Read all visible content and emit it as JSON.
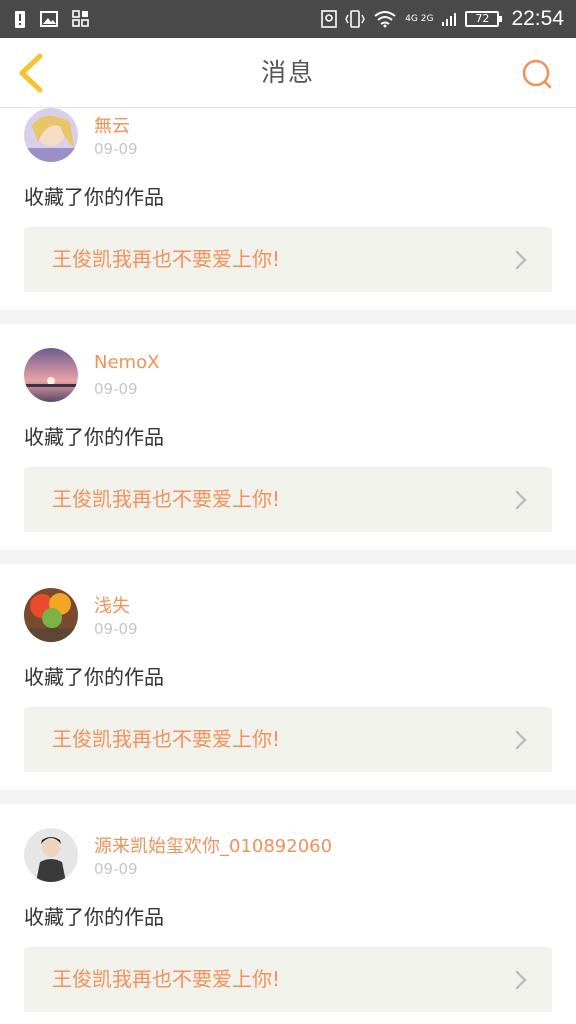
{
  "status_bar": {
    "time": "22:54",
    "battery": "72",
    "network": "4G 2G"
  },
  "header": {
    "title": "消息"
  },
  "notifications": [
    {
      "username": "無云",
      "date": "09-09",
      "action": "收藏了你的作品",
      "work_title": "王俊凯我再也不要爱上你!"
    },
    {
      "username": "NemoX",
      "date": "09-09",
      "action": "收藏了你的作品",
      "work_title": "王俊凯我再也不要爱上你!"
    },
    {
      "username": "浅失",
      "date": "09-09",
      "action": "收藏了你的作品",
      "work_title": "王俊凯我再也不要爱上你!"
    },
    {
      "username": "源来凯始玺欢你_010892060",
      "date": "09-09",
      "action": "收藏了你的作品",
      "work_title": "王俊凯我再也不要爱上你!"
    }
  ],
  "colors": {
    "accent": "#f0925a",
    "back_icon": "#f5c531",
    "status_bar": "#4a4a4a",
    "work_bg": "#f2f2ec"
  },
  "icons": {
    "back": "chevron-left-icon",
    "search": "search-icon",
    "card_arrow": "chevron-right-icon"
  }
}
